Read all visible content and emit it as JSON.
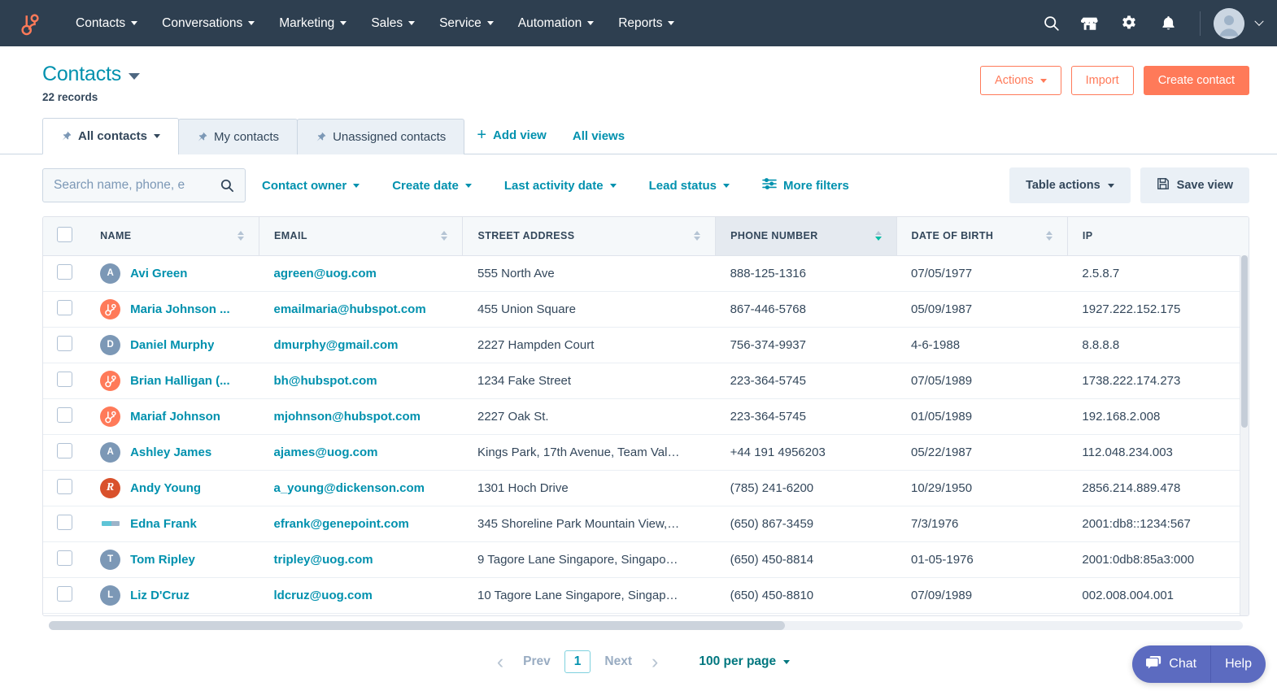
{
  "topnav": {
    "logo_name": "hubspot-sprocket-logo",
    "items": [
      {
        "label": "Contacts",
        "has_caret": true
      },
      {
        "label": "Conversations",
        "has_caret": true
      },
      {
        "label": "Marketing",
        "has_caret": true
      },
      {
        "label": "Sales",
        "has_caret": true
      },
      {
        "label": "Service",
        "has_caret": true
      },
      {
        "label": "Automation",
        "has_caret": true
      },
      {
        "label": "Reports",
        "has_caret": true
      }
    ],
    "icons": [
      "search-icon",
      "marketplace-icon",
      "settings-gear-icon",
      "notifications-bell-icon"
    ],
    "avatar_name": "user-avatar"
  },
  "header": {
    "title": "Contacts",
    "record_count": "22 records",
    "actions_label": "Actions",
    "import_label": "Import",
    "create_label": "Create contact"
  },
  "tabs": {
    "items": [
      {
        "label": "All contacts",
        "active": true,
        "pinned": true,
        "has_caret": true
      },
      {
        "label": "My contacts",
        "active": false,
        "pinned": true,
        "has_caret": false
      },
      {
        "label": "Unassigned contacts",
        "active": false,
        "pinned": true,
        "has_caret": false
      }
    ],
    "add_view_label": "Add view",
    "all_views_label": "All views"
  },
  "filters": {
    "search_placeholder": "Search name, phone, e",
    "search_value": "",
    "items": [
      {
        "label": "Contact owner"
      },
      {
        "label": "Create date"
      },
      {
        "label": "Last activity date"
      },
      {
        "label": "Lead status"
      }
    ],
    "more_filters_label": "More filters",
    "table_actions_label": "Table actions",
    "save_view_label": "Save view"
  },
  "table": {
    "columns": [
      {
        "key": "name",
        "label": "NAME",
        "sorted": false,
        "sort_dir": "none"
      },
      {
        "key": "email",
        "label": "EMAIL",
        "sorted": false,
        "sort_dir": "none"
      },
      {
        "key": "addr",
        "label": "STREET ADDRESS",
        "sorted": false,
        "sort_dir": "none"
      },
      {
        "key": "phone",
        "label": "PHONE NUMBER",
        "sorted": true,
        "sort_dir": "desc"
      },
      {
        "key": "dob",
        "label": "DATE OF BIRTH",
        "sorted": false,
        "sort_dir": "none"
      },
      {
        "key": "ip",
        "label": "IP",
        "sorted": false,
        "sort_dir": "none"
      }
    ],
    "rows": [
      {
        "avatar": {
          "type": "letter",
          "text": "A"
        },
        "name": "Avi Green",
        "email": "agreen@uog.com",
        "addr": "555 North Ave",
        "phone": "888-125-1316",
        "dob": "07/05/1977",
        "ip": "2.5.8.7",
        "checked": false
      },
      {
        "avatar": {
          "type": "hubspot",
          "text": ""
        },
        "name": "Maria Johnson ...",
        "email": "emailmaria@hubspot.com",
        "addr": "455 Union Square",
        "phone": "867-446-5768",
        "dob": "05/09/1987",
        "ip": "1927.222.152.175",
        "checked": false
      },
      {
        "avatar": {
          "type": "letter",
          "text": "D"
        },
        "name": "Daniel Murphy",
        "email": "dmurphy@gmail.com",
        "addr": "2227 Hampden Court",
        "phone": "756-374-9937",
        "dob": "4-6-1988",
        "ip": "8.8.8.8",
        "checked": false
      },
      {
        "avatar": {
          "type": "hubspot",
          "text": ""
        },
        "name": "Brian Halligan (...",
        "email": "bh@hubspot.com",
        "addr": "1234 Fake Street",
        "phone": "223-364-5745",
        "dob": "07/05/1989",
        "ip": "1738.222.174.273",
        "checked": false
      },
      {
        "avatar": {
          "type": "hubspot",
          "text": ""
        },
        "name": "Mariaf Johnson",
        "email": "mjohnson@hubspot.com",
        "addr": "2227 Oak St.",
        "phone": "223-364-5745",
        "dob": "01/05/1989",
        "ip": "192.168.2.008",
        "checked": false
      },
      {
        "avatar": {
          "type": "letter",
          "text": "A"
        },
        "name": "Ashley James",
        "email": "ajames@uog.com",
        "addr": "Kings Park, 17th Avenue, Team Val…",
        "phone": "+44 191 4956203",
        "dob": "05/22/1987",
        "ip": "112.048.234.003",
        "checked": false
      },
      {
        "avatar": {
          "type": "rlogo",
          "text": "R"
        },
        "name": "Andy Young",
        "email": "a_young@dickenson.com",
        "addr": "1301 Hoch Drive",
        "phone": "(785) 241-6200",
        "dob": "10/29/1950",
        "ip": "2856.214.889.478",
        "checked": false
      },
      {
        "avatar": {
          "type": "image",
          "text": ""
        },
        "name": "Edna Frank",
        "email": "efrank@genepoint.com",
        "addr": "345 Shoreline Park Mountain View,…",
        "phone": "(650) 867-3459",
        "dob": "7/3/1976",
        "ip": "2001:db8::1234:567",
        "checked": false
      },
      {
        "avatar": {
          "type": "letter",
          "text": "T"
        },
        "name": "Tom Ripley",
        "email": "tripley@uog.com",
        "addr": "9 Tagore Lane Singapore, Singapo…",
        "phone": "(650) 450-8814",
        "dob": "01-05-1976",
        "ip": "2001:0db8:85a3:000",
        "checked": false
      },
      {
        "avatar": {
          "type": "letter",
          "text": "L"
        },
        "name": "Liz D'Cruz",
        "email": "ldcruz@uog.com",
        "addr": "10 Tagore Lane Singapore, Singap…",
        "phone": "(650) 450-8810",
        "dob": "07/09/1989",
        "ip": "002.008.004.001",
        "checked": false
      }
    ],
    "select_all_checked": false
  },
  "pagination": {
    "prev_label": "Prev",
    "current_page": "1",
    "next_label": "Next",
    "per_page_label": "100 per page"
  },
  "chat": {
    "chat_label": "Chat",
    "help_label": "Help"
  },
  "colors": {
    "brand_orange": "#ff7a59",
    "nav_dark": "#2e3f50",
    "link_teal": "#0091ae",
    "text_slate": "#33475b",
    "sort_active": "#00bda5",
    "chat_purple": "#5c6bc0"
  }
}
